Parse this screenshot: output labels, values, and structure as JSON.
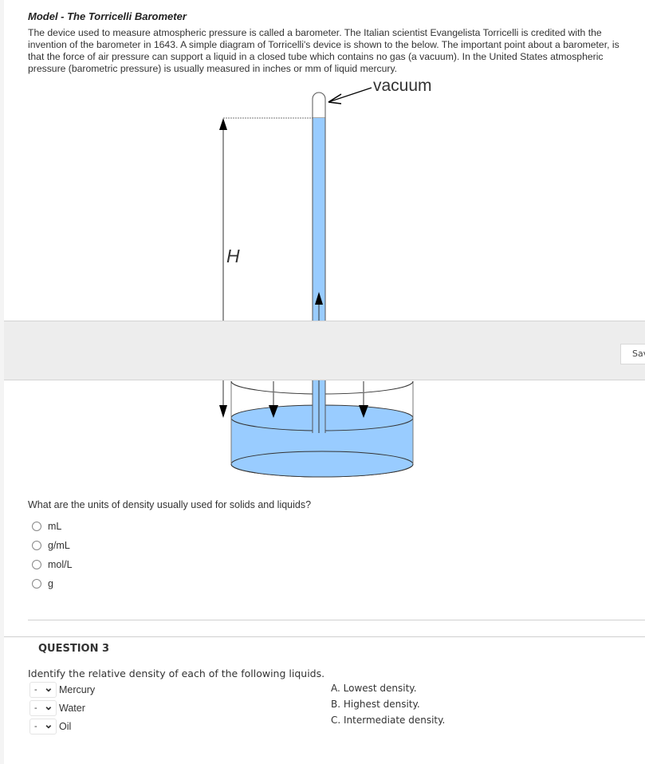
{
  "model": {
    "title": "Model - The Torricelli Barometer",
    "paragraph": "The device used to measure atmospheric pressure is called a barometer.  The Italian scientist Evangelista Torricelli is credited with the invention of the barometer in 1643.  A simple diagram of Torricelli's device is shown to the below. The important point about a barometer, is that the force of air pressure can support a liquid in a closed tube which contains no gas (a vacuum). In the United States atmospheric pressure (barometric pressure) is usually measured in inches or mm of liquid mercury."
  },
  "diagram": {
    "vacuum_label": "vacuum",
    "height_label": "H",
    "liquid_color": "#99ccff",
    "line_color": "#333333"
  },
  "save_bar": {
    "save_label": "Save"
  },
  "question2": {
    "prompt": "What are the units of density usually used for solids and liquids?",
    "options": [
      {
        "label": "mL",
        "selected": false
      },
      {
        "label": "g/mL",
        "selected": false
      },
      {
        "label": "mol/L",
        "selected": false
      },
      {
        "label": "g",
        "selected": false
      }
    ]
  },
  "question3": {
    "title": "QUESTION 3",
    "prompt": "Identify the relative density of each of the following liquids.",
    "items": [
      {
        "select_value": "-",
        "label": "Mercury"
      },
      {
        "select_value": "-",
        "label": "Water"
      },
      {
        "select_value": "-",
        "label": "Oil"
      }
    ],
    "answers": [
      "A. Lowest density.",
      "B. Highest density.",
      "C. Intermediate density."
    ]
  }
}
